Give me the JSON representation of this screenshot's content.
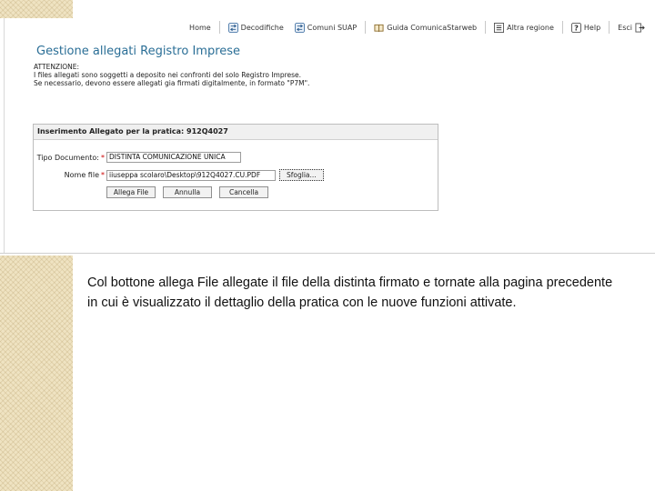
{
  "nav": {
    "items": [
      {
        "label": "Home",
        "icon": "home-icon"
      },
      {
        "label": "Decodifiche",
        "icon": "arrows-icon"
      },
      {
        "label": "Comuni SUAP",
        "icon": "arrows-icon"
      },
      {
        "label": "Guida ComunicaStarweb",
        "icon": "book-icon"
      },
      {
        "label": "Altra regione",
        "icon": "list-icon"
      },
      {
        "label": "Help",
        "icon": "help-icon"
      },
      {
        "label": "Esci",
        "icon": "exit-icon"
      }
    ]
  },
  "page": {
    "title": "Gestione allegati Registro Imprese",
    "warning_title": "ATTENZIONE:",
    "warning_line1": "I files allegati sono soggetti a deposito nei confronti del solo Registro Imprese.",
    "warning_line2": "Se necessario, devono essere allegati gia firmati digitalmente, in formato \"P7M\"."
  },
  "form": {
    "header": "Inserimento Allegato per la pratica: 912Q4027",
    "doc_type_label": "Tipo Documento:",
    "doc_type_value": "DISTINTA COMUNICAZIONE UNICA",
    "required_mark": "*",
    "file_label": "Nome file",
    "file_value": "iiuseppa scolaro\\Desktop\\912Q4027.CU.PDF",
    "browse_label": "Sfoglia...",
    "attach_button": "Allega File",
    "cancel_button": "Annulla",
    "delete_button": "Cancella"
  },
  "caption": {
    "text": "Col bottone allega File allegate il file della distinta firmato e tornate alla pagina precedente in cui è visualizzato il dettaglio della pratica con le nuove funzioni attivate."
  }
}
